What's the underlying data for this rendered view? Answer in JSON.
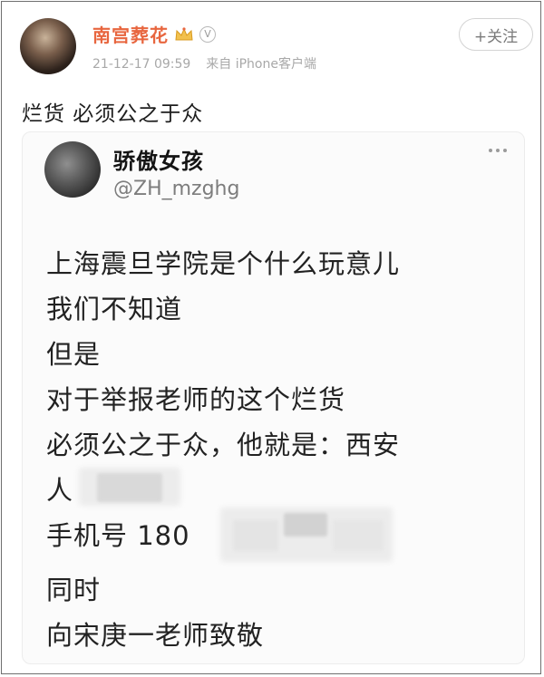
{
  "post": {
    "author": "南宫葬花",
    "vip_badge": "V",
    "time": "21-12-17 09:59",
    "source": "来自 iPhone客户端",
    "follow_label": "+关注",
    "text": "烂货 必须公之于众",
    "author_color": "#e8663f"
  },
  "quoted": {
    "name": "骄傲女孩",
    "handle": "@ZH_mzghg",
    "lines": [
      "上海震旦学院是个什么玩意儿",
      "我们不知道",
      "但是",
      "对于举报老师的这个烂货",
      "必须公之于众，他就是：西安",
      "人",
      "手机号 180",
      "同时",
      "向宋庚一老师致敬"
    ]
  },
  "icons": {
    "crown": "crown-icon",
    "vip": "vip-icon",
    "more": "more-icon"
  }
}
